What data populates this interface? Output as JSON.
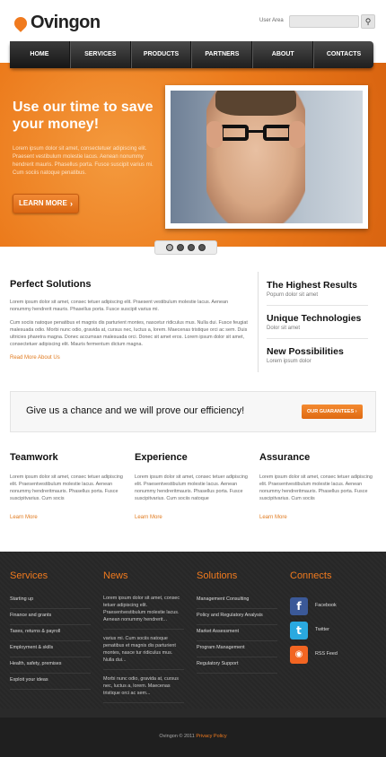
{
  "header": {
    "brand": "Ovingon",
    "user_area": "User Area",
    "search_placeholder": ""
  },
  "nav": {
    "items": [
      "HOME",
      "SERVICES",
      "PRODUCTS",
      "PARTNERS",
      "ABOUT",
      "CONTACTS"
    ]
  },
  "hero": {
    "title": "Use our time to save your money!",
    "text": "Lorem ipsum dolor sit amet, consectetuer adipiscing elit. Praesent vestibulum molestie lacus. Aenean nonummy hendrerit mauris. Phasellus porta. Fusce suscipit varius mi. Cum sociis natoque penatibus.",
    "button": "LEARN MORE",
    "slides": 4,
    "active_slide": 1
  },
  "perfect": {
    "title": "Perfect Solutions",
    "p1": "Lorem ipsum dolor sit amet, consec tetuer adipiscing elit. Praesent vestibulum molestie lacus. Aenean nonummy hendrerit mauris. Phasellus porta. Fusce suscipit varius mi.",
    "p2": "Cum sociis natoque penatibus et magnis dis parturient montes, nascetur ridiculus mus. Nulla dui. Fusce feugiat malesuada odio. Morbi nunc odio, gravida at, cursus nec, luctus a, lorem. Maecenas tristique orci ac sem. Duis ultricies pharetra magna. Donec accumsan malesuada orci. Donec sit amet eros. Lorem ipsum dolor sit amet, consectetuer adipiscing elit. Mauris fermentum dictum magna.",
    "link": "Read More About Us"
  },
  "side": [
    {
      "title": "The Highest Results",
      "sub": "Popurn dolor sit amet"
    },
    {
      "title": "Unique Technologies",
      "sub": "Dolor sit amet"
    },
    {
      "title": "New Possibilities",
      "sub": "Lorem ipsum dolor"
    }
  ],
  "banner": {
    "text": "Give us a chance and we will prove our efficiency!",
    "button": "OUR GUARANTEES"
  },
  "columns": [
    {
      "title": "Teamwork",
      "text": "Lorem ipsum dolor sit amet, consec tetuer adipiscing elit. Praesentvestibulum molestie lacus. Aenean nonummy hendreritmauris. Phasellus porta. Fusce suscipitvarius. Cum socis",
      "link": "Learn More"
    },
    {
      "title": "Experience",
      "text": "Lorem ipsum dolor sit amet, consec tetuer adipiscing elit. Praesentvestibulum molestie lacus. Aenean nonummy hendreritmauris. Phasellus porta. Fusce suscipitvarius. Cum sociis natoque",
      "link": "Learn More"
    },
    {
      "title": "Assurance",
      "text": "Lorem ipsum dolor sit amet, consec tetuer adipiscing elit. Praesentvestibulum molestie lacus. Aenean nonummy hendreritmauris. Phasellus porta. Fusce suscipitvarius. Cum sociis",
      "link": "Learn More"
    }
  ],
  "footer": {
    "services_title": "Services",
    "services": [
      "Starting up",
      "Finance and grants",
      "Taxes, returns & payroll",
      "Employment & skills",
      "Health, safety, premises",
      "Exploit your ideas"
    ],
    "news_title": "News",
    "news": [
      "Lorem ipsum dolor sit amet, consec tetuer adipiscing elit. Praesentvestibulum molestie lacus. Aenean nonummy hendrerit...",
      "varius mi. Cum sociis natoque penatibus et magnis dis parturient montes, nasce tur ridiculus mus. Nulla dui...",
      "Morbi nunc odio, gravida at, cursus nec, luctus a, lorem. Maecenas tristique orci ac sem..."
    ],
    "solutions_title": "Solutions",
    "solutions": [
      "Management Consulting",
      "Policy and Regulatory Analysis",
      "Market Assessment",
      "Program Management",
      "Regulatory Support"
    ],
    "connects_title": "Connects",
    "social": [
      {
        "label": "Facebook",
        "glyph": "f",
        "color": "#3b5998"
      },
      {
        "label": "Twitter",
        "glyph": "t",
        "color": "#2aa9e0"
      },
      {
        "label": "RSS Feed",
        "glyph": "◉",
        "color": "#f26522"
      }
    ],
    "copyright": "Ovingon © 2011",
    "privacy": "Privacy Policy"
  }
}
